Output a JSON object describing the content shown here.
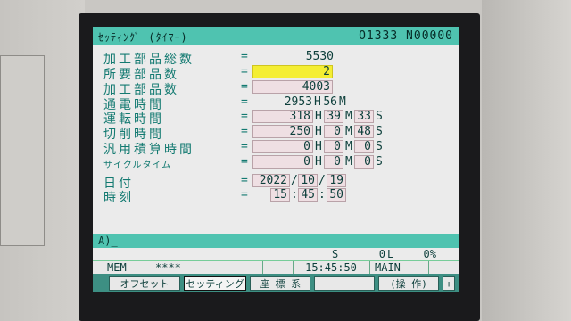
{
  "header": {
    "title": "ｾｯﾃｨﾝｸﾞ (ﾀｲﾏｰ)",
    "program": "O1333 N00000"
  },
  "rows": [
    {
      "label": "加工部品総数",
      "eq": "=",
      "value": "5530"
    },
    {
      "label": "所要部品数",
      "eq": "=",
      "value": "2"
    },
    {
      "label": "加工部品数",
      "eq": "=",
      "value": "4003"
    },
    {
      "label": "通電時間",
      "eq": "=",
      "h": "2953",
      "m": "56"
    },
    {
      "label": "運転時間",
      "eq": "=",
      "h": "318",
      "m": "39",
      "s": "33"
    },
    {
      "label": "切削時間",
      "eq": "=",
      "h": "250",
      "m": "0",
      "s": "48"
    },
    {
      "label": "汎用積算時間",
      "eq": "=",
      "h": "0",
      "m": "0",
      "s": "0"
    },
    {
      "label": "サイクルタイム",
      "eq": "=",
      "h": "0",
      "m": "0",
      "s": "0"
    },
    {
      "label": "日付",
      "eq": "=",
      "year": "2022",
      "month": "10",
      "day": "19"
    },
    {
      "label": "時刻",
      "eq": "=",
      "hour": "15",
      "minute": "45",
      "second": "50"
    }
  ],
  "units": {
    "h": "H",
    "m": "M",
    "s": "S",
    "date_sep": "/",
    "time_sep": ":"
  },
  "command_line": "A)_",
  "status_top": {
    "mode_s": "S",
    "value": "0",
    "unit": "L",
    "percent": "0%"
  },
  "status_bottom": {
    "mode": "MEM",
    "stars": "****",
    "time": "15:45:50",
    "state": "MAIN"
  },
  "softkeys": [
    {
      "label": "オフセット",
      "active": false
    },
    {
      "label": "セッティング",
      "active": true
    },
    {
      "label": "座 標 系",
      "active": false
    },
    {
      "label": "",
      "active": false
    },
    {
      "label": "(操 作)",
      "active": false
    },
    {
      "label": "+",
      "active": false
    }
  ]
}
